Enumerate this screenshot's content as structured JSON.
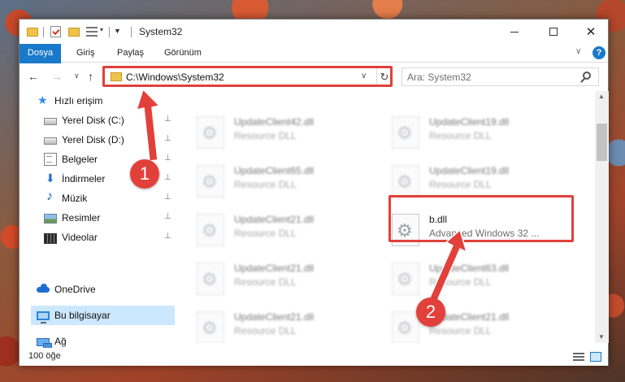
{
  "window": {
    "title": "System32",
    "minimize_symbol": "",
    "maximize_symbol": "",
    "close_symbol": "✕"
  },
  "ribbon": {
    "tabs": [
      "Dosya",
      "Giriş",
      "Paylaş",
      "Görünüm"
    ],
    "help_symbol": "?",
    "collapse_symbol": "∨"
  },
  "navigation": {
    "back_symbol": "←",
    "forward_symbol": "→",
    "recent_symbol": "∨",
    "up_symbol": "↑",
    "address": "C:\\Windows\\System32",
    "address_dropdown_symbol": "∨",
    "refresh_symbol": "↻",
    "search_placeholder": "Ara: System32"
  },
  "sidebar": {
    "pin_symbol": "📌",
    "items": [
      {
        "label": "Hızlı erişim",
        "icon": "star-icon",
        "pinned": false
      },
      {
        "label": "Yerel Disk (C:)",
        "icon": "drive-icon",
        "pinned": true
      },
      {
        "label": "Yerel Disk (D:)",
        "icon": "drive-icon",
        "pinned": true
      },
      {
        "label": "Belgeler",
        "icon": "documents-icon",
        "pinned": true
      },
      {
        "label": "İndirmeler",
        "icon": "downloads-icon",
        "pinned": true
      },
      {
        "label": "Müzik",
        "icon": "music-icon",
        "pinned": true
      },
      {
        "label": "Resimler",
        "icon": "pictures-icon",
        "pinned": true
      },
      {
        "label": "Videolar",
        "icon": "videos-icon",
        "pinned": true
      },
      {
        "label": "OneDrive",
        "icon": "onedrive-icon",
        "pinned": false
      },
      {
        "label": "Bu bilgisayar",
        "icon": "this-pc-icon",
        "pinned": false,
        "selected": true
      },
      {
        "label": "Ağ",
        "icon": "network-icon",
        "pinned": false
      }
    ]
  },
  "files": [
    {
      "name": "UpdateClient42.dll",
      "type": "Resource DLL",
      "blurred": true
    },
    {
      "name": "UpdateClient19.dll",
      "type": "Resource DLL",
      "blurred": true
    },
    {
      "name": "UpdateClient65.dll",
      "type": "Resource DLL",
      "blurred": true
    },
    {
      "name": "UpdateClient19.dll",
      "type": "Resource DLL",
      "blurred": true
    },
    {
      "name": "UpdateClient21.dll",
      "type": "Resource DLL",
      "blurred": true
    },
    {
      "name": "b.dll",
      "type": "Advanced Windows 32 ...",
      "blurred": false,
      "highlighted": true
    },
    {
      "name": "UpdateClient21.dll",
      "type": "Resource DLL",
      "blurred": true
    },
    {
      "name": "UpdateClient63.dll",
      "type": "Resource DLL",
      "blurred": true
    },
    {
      "name": "UpdateClient21.dll",
      "type": "Resource DLL",
      "blurred": true
    },
    {
      "name": "UpdateClient21.dll",
      "type": "Resource DLL",
      "blurred": true
    },
    {
      "name": "UpdateClient21.dll",
      "type": "Resource DLL",
      "blurred": true
    },
    {
      "name": "UpdateClient21.dll",
      "type": "Resource DLL",
      "blurred": true
    }
  ],
  "status": {
    "item_count": "100 öğe"
  },
  "annotations": {
    "step1": "1",
    "step2": "2",
    "color": "#e2403b"
  },
  "colors": {
    "accent": "#1979ca",
    "selection": "#cce8ff"
  }
}
